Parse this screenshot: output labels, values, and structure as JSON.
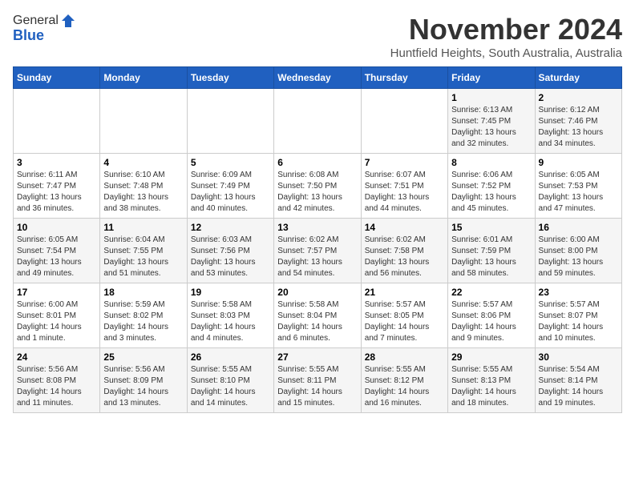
{
  "header": {
    "logo_general": "General",
    "logo_blue": "Blue",
    "month_title": "November 2024",
    "location": "Huntfield Heights, South Australia, Australia"
  },
  "calendar": {
    "days_of_week": [
      "Sunday",
      "Monday",
      "Tuesday",
      "Wednesday",
      "Thursday",
      "Friday",
      "Saturday"
    ],
    "weeks": [
      [
        {
          "day": "",
          "info": ""
        },
        {
          "day": "",
          "info": ""
        },
        {
          "day": "",
          "info": ""
        },
        {
          "day": "",
          "info": ""
        },
        {
          "day": "",
          "info": ""
        },
        {
          "day": "1",
          "info": "Sunrise: 6:13 AM\nSunset: 7:45 PM\nDaylight: 13 hours\nand 32 minutes."
        },
        {
          "day": "2",
          "info": "Sunrise: 6:12 AM\nSunset: 7:46 PM\nDaylight: 13 hours\nand 34 minutes."
        }
      ],
      [
        {
          "day": "3",
          "info": "Sunrise: 6:11 AM\nSunset: 7:47 PM\nDaylight: 13 hours\nand 36 minutes."
        },
        {
          "day": "4",
          "info": "Sunrise: 6:10 AM\nSunset: 7:48 PM\nDaylight: 13 hours\nand 38 minutes."
        },
        {
          "day": "5",
          "info": "Sunrise: 6:09 AM\nSunset: 7:49 PM\nDaylight: 13 hours\nand 40 minutes."
        },
        {
          "day": "6",
          "info": "Sunrise: 6:08 AM\nSunset: 7:50 PM\nDaylight: 13 hours\nand 42 minutes."
        },
        {
          "day": "7",
          "info": "Sunrise: 6:07 AM\nSunset: 7:51 PM\nDaylight: 13 hours\nand 44 minutes."
        },
        {
          "day": "8",
          "info": "Sunrise: 6:06 AM\nSunset: 7:52 PM\nDaylight: 13 hours\nand 45 minutes."
        },
        {
          "day": "9",
          "info": "Sunrise: 6:05 AM\nSunset: 7:53 PM\nDaylight: 13 hours\nand 47 minutes."
        }
      ],
      [
        {
          "day": "10",
          "info": "Sunrise: 6:05 AM\nSunset: 7:54 PM\nDaylight: 13 hours\nand 49 minutes."
        },
        {
          "day": "11",
          "info": "Sunrise: 6:04 AM\nSunset: 7:55 PM\nDaylight: 13 hours\nand 51 minutes."
        },
        {
          "day": "12",
          "info": "Sunrise: 6:03 AM\nSunset: 7:56 PM\nDaylight: 13 hours\nand 53 minutes."
        },
        {
          "day": "13",
          "info": "Sunrise: 6:02 AM\nSunset: 7:57 PM\nDaylight: 13 hours\nand 54 minutes."
        },
        {
          "day": "14",
          "info": "Sunrise: 6:02 AM\nSunset: 7:58 PM\nDaylight: 13 hours\nand 56 minutes."
        },
        {
          "day": "15",
          "info": "Sunrise: 6:01 AM\nSunset: 7:59 PM\nDaylight: 13 hours\nand 58 minutes."
        },
        {
          "day": "16",
          "info": "Sunrise: 6:00 AM\nSunset: 8:00 PM\nDaylight: 13 hours\nand 59 minutes."
        }
      ],
      [
        {
          "day": "17",
          "info": "Sunrise: 6:00 AM\nSunset: 8:01 PM\nDaylight: 14 hours\nand 1 minute."
        },
        {
          "day": "18",
          "info": "Sunrise: 5:59 AM\nSunset: 8:02 PM\nDaylight: 14 hours\nand 3 minutes."
        },
        {
          "day": "19",
          "info": "Sunrise: 5:58 AM\nSunset: 8:03 PM\nDaylight: 14 hours\nand 4 minutes."
        },
        {
          "day": "20",
          "info": "Sunrise: 5:58 AM\nSunset: 8:04 PM\nDaylight: 14 hours\nand 6 minutes."
        },
        {
          "day": "21",
          "info": "Sunrise: 5:57 AM\nSunset: 8:05 PM\nDaylight: 14 hours\nand 7 minutes."
        },
        {
          "day": "22",
          "info": "Sunrise: 5:57 AM\nSunset: 8:06 PM\nDaylight: 14 hours\nand 9 minutes."
        },
        {
          "day": "23",
          "info": "Sunrise: 5:57 AM\nSunset: 8:07 PM\nDaylight: 14 hours\nand 10 minutes."
        }
      ],
      [
        {
          "day": "24",
          "info": "Sunrise: 5:56 AM\nSunset: 8:08 PM\nDaylight: 14 hours\nand 11 minutes."
        },
        {
          "day": "25",
          "info": "Sunrise: 5:56 AM\nSunset: 8:09 PM\nDaylight: 14 hours\nand 13 minutes."
        },
        {
          "day": "26",
          "info": "Sunrise: 5:55 AM\nSunset: 8:10 PM\nDaylight: 14 hours\nand 14 minutes."
        },
        {
          "day": "27",
          "info": "Sunrise: 5:55 AM\nSunset: 8:11 PM\nDaylight: 14 hours\nand 15 minutes."
        },
        {
          "day": "28",
          "info": "Sunrise: 5:55 AM\nSunset: 8:12 PM\nDaylight: 14 hours\nand 16 minutes."
        },
        {
          "day": "29",
          "info": "Sunrise: 5:55 AM\nSunset: 8:13 PM\nDaylight: 14 hours\nand 18 minutes."
        },
        {
          "day": "30",
          "info": "Sunrise: 5:54 AM\nSunset: 8:14 PM\nDaylight: 14 hours\nand 19 minutes."
        }
      ]
    ]
  }
}
